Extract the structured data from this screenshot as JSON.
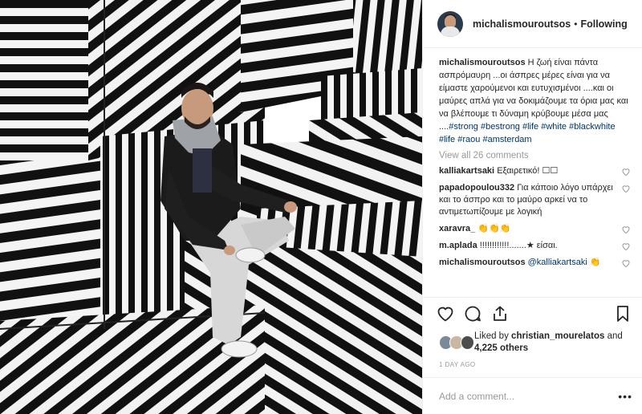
{
  "header": {
    "username": "michalismouroutsos",
    "separator": "•",
    "follow_status": "Following"
  },
  "caption": {
    "username": "michalismouroutsos",
    "text": "Η ζωή είναι πάντα ασπρόμαυρη ...οι άσπρες μέρες είναι για να είμαστε χαρούμενοι και ευτυχισμένοι ....και οι μαύρες απλά για να δοκιμάζουμε τα όρια μας και να βλέπουμε τι δύναμη κρύβουμε μέσα μας ....",
    "hashtags": [
      "#strong",
      "#bestrong",
      "#life",
      "#white",
      "#blackwhite",
      "#life",
      "#raou",
      "#amsterdam"
    ]
  },
  "view_all_comments": "View all 26 comments",
  "comments": [
    {
      "username": "kalliakartsaki",
      "text": "Εξαιρετικό! ☐☐"
    },
    {
      "username": "papadopoulou332",
      "text": "Για κάποιο λόγο υπάρχει και το άσπρο και το μαύρο αρκεί να το αντιμετωπίζουμε με λογική"
    },
    {
      "username": "xaravra_",
      "text": "👏👏👏"
    },
    {
      "username": "m.aplada",
      "text": "!!!!!!!!!!!!.......★ είσαι."
    },
    {
      "username": "michalismouroutsos",
      "mention": "@kalliakartsaki",
      "text": "👏"
    }
  ],
  "actions": {
    "like_icon": "heart-icon",
    "comment_icon": "comment-icon",
    "share_icon": "share-icon",
    "save_icon": "bookmark-icon"
  },
  "likes": {
    "prefix": "Liked by",
    "user": "christian_mourelatos",
    "joiner": "and",
    "count": "4,225 others"
  },
  "timestamp": "1 DAY AGO",
  "add_comment": {
    "placeholder": "Add a comment...",
    "more_label": "•••"
  },
  "colors": {
    "text": "#262626",
    "muted": "#999999",
    "link": "#003569",
    "border": "#efefef"
  }
}
